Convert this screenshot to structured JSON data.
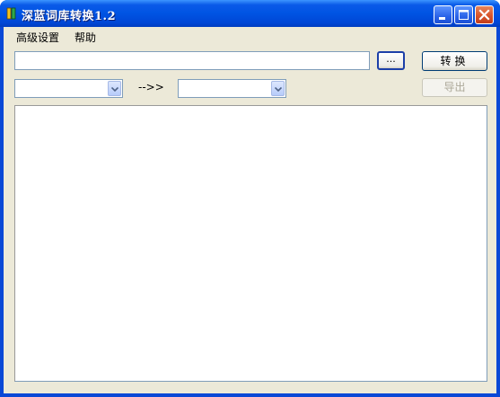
{
  "window": {
    "title": "深蓝词库转换1.2",
    "accent_color": "#0054e3",
    "icon": "app-book-icon",
    "caption_buttons": [
      "minimize-icon",
      "maximize-icon",
      "close-icon"
    ]
  },
  "menu": {
    "items": [
      {
        "label": "高级设置"
      },
      {
        "label": "帮助"
      }
    ]
  },
  "toolbar": {
    "path_value": "",
    "browse_label": "...",
    "convert_label": "转换",
    "export_label": "导出",
    "arrow_label": "-->>",
    "source_format": "",
    "target_format": ""
  },
  "output": {
    "text": ""
  }
}
